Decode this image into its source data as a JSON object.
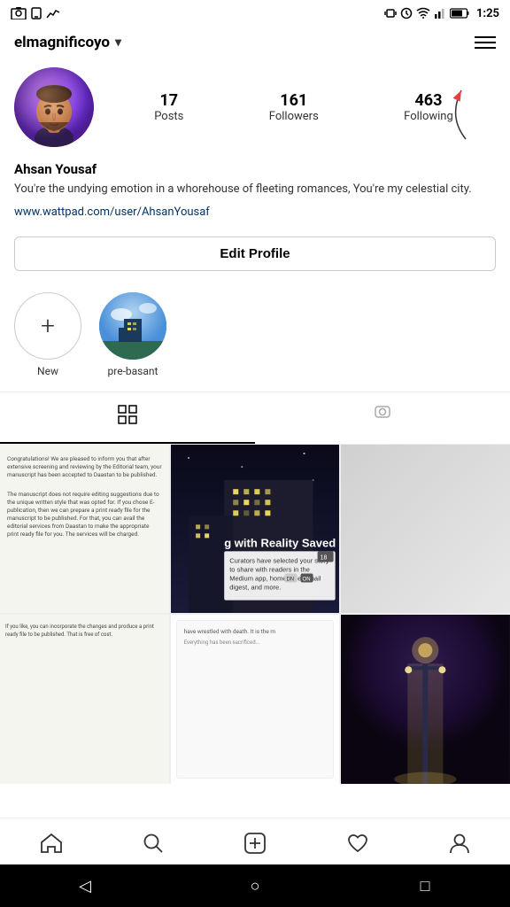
{
  "statusBar": {
    "time": "1:25",
    "icons": [
      "signal",
      "alarm",
      "wifi",
      "battery"
    ]
  },
  "topNav": {
    "username": "elmagnificoyo",
    "chevron": "▾",
    "menuIcon": "☰"
  },
  "profile": {
    "stats": {
      "posts": {
        "number": "17",
        "label": "Posts"
      },
      "followers": {
        "number": "161",
        "label": "Followers"
      },
      "following": {
        "number": "463",
        "label": "Following"
      }
    },
    "name": "Ahsan Yousaf",
    "bio": "You're the undying emotion in a whorehouse of fleeting romances, You're my celestial city.",
    "link": "www.wattpad.com/user/AhsanYousaf"
  },
  "editProfileBtn": "Edit Profile",
  "stories": [
    {
      "label": "New",
      "type": "new"
    },
    {
      "label": "pre-basant",
      "type": "image"
    }
  ],
  "tabs": [
    {
      "icon": "grid",
      "active": true
    },
    {
      "icon": "person",
      "active": false
    }
  ],
  "bottomNav": [
    {
      "icon": "home",
      "label": "home"
    },
    {
      "icon": "search",
      "label": "search"
    },
    {
      "icon": "plus-square",
      "label": "add"
    },
    {
      "icon": "heart",
      "label": "likes"
    },
    {
      "icon": "profile",
      "label": "profile"
    }
  ],
  "androidNav": {
    "back": "◁",
    "home": "○",
    "recent": "□"
  }
}
